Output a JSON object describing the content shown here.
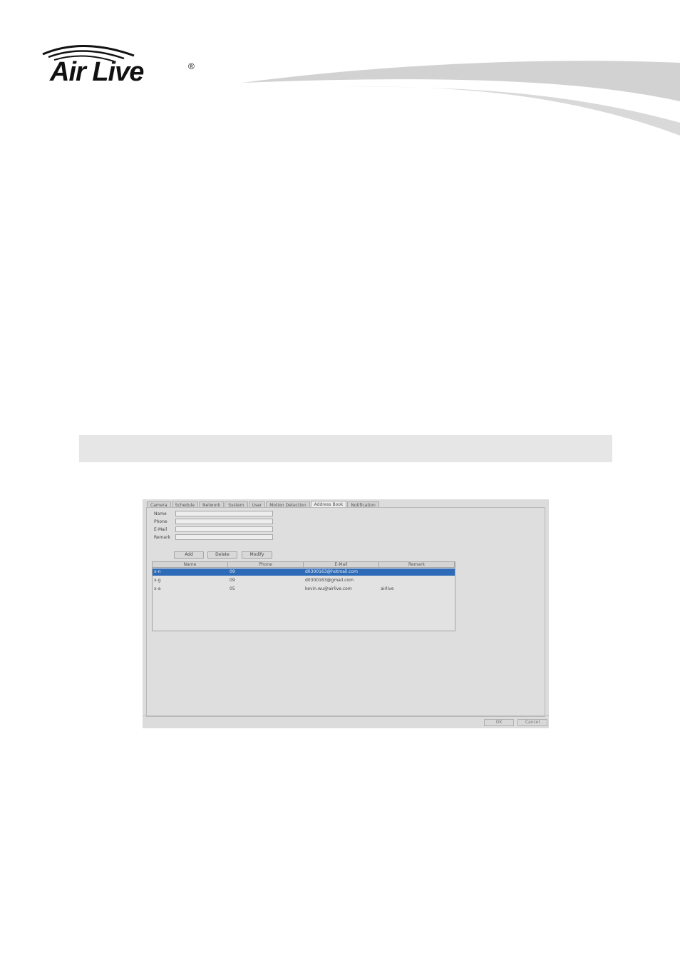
{
  "brand": {
    "name": "Air Live",
    "registered_mark": "®"
  },
  "dialog": {
    "tabs": [
      "Camera",
      "Schedule",
      "Network",
      "System",
      "User",
      "Motion Detection",
      "Address Book",
      "Notification"
    ],
    "active_tab": "Address Book",
    "form": {
      "name_label": "Name",
      "phone_label": "Phone",
      "email_label": "E-Mail",
      "remark_label": "Remark",
      "name_value": "",
      "phone_value": "",
      "email_value": "",
      "remark_value": ""
    },
    "buttons": {
      "add": "Add",
      "delete": "Delete",
      "modify": "Modify"
    },
    "table": {
      "columns": [
        "Name",
        "Phone",
        "E-Mail",
        "Remark"
      ],
      "rows": [
        {
          "name": "x-n",
          "phone": "09",
          "email": "d0300163@hotmail.com",
          "remark": ""
        },
        {
          "name": "x-g",
          "phone": "09",
          "email": "d0300163@gmail.com",
          "remark": ""
        },
        {
          "name": "x-a",
          "phone": "05",
          "email": "kevin.wu@airlive.com",
          "remark": "airlive"
        }
      ],
      "selected_row": 0
    },
    "footer": {
      "ok": "OK",
      "cancel": "Cancel"
    }
  },
  "colors": {
    "selection": "#2d6ab8",
    "section_bar": "#e6e6e6"
  }
}
